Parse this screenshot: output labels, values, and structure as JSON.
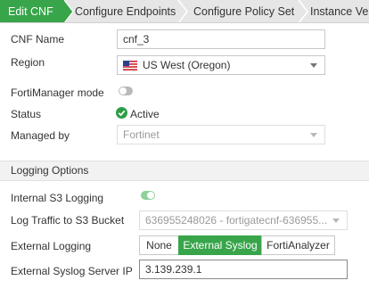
{
  "wizard": {
    "steps": [
      {
        "label": "Edit CNF"
      },
      {
        "label": "Configure Endpoints"
      },
      {
        "label": "Configure Policy Set"
      },
      {
        "label": "Instance Ver"
      }
    ],
    "active_color": "#38a54a"
  },
  "form": {
    "cnf_name": {
      "label": "CNF Name",
      "value": "cnf_3"
    },
    "region": {
      "label": "Region",
      "value": "US West (Oregon)",
      "flag": "us-flag-icon"
    },
    "fortimanager_mode": {
      "label": "FortiManager mode",
      "enabled": false
    },
    "status": {
      "label": "Status",
      "value": "Active",
      "icon": "check-circle-icon",
      "color": "#2e9e46"
    },
    "managed_by": {
      "label": "Managed by",
      "value": "Fortinet"
    }
  },
  "logging": {
    "section_title": "Logging Options",
    "internal_s3": {
      "label": "Internal S3 Logging",
      "enabled": true
    },
    "log_traffic_bucket": {
      "label": "Log Traffic to S3 Bucket",
      "value": "636955248026 - fortigatecnf-636955..."
    },
    "external_logging": {
      "label": "External Logging",
      "options": [
        "None",
        "External Syslog",
        "FortiAnalyzer"
      ],
      "selected": "External Syslog"
    },
    "syslog_server_ip": {
      "label": "External Syslog Server IP",
      "value": "3.139.239.1"
    }
  }
}
